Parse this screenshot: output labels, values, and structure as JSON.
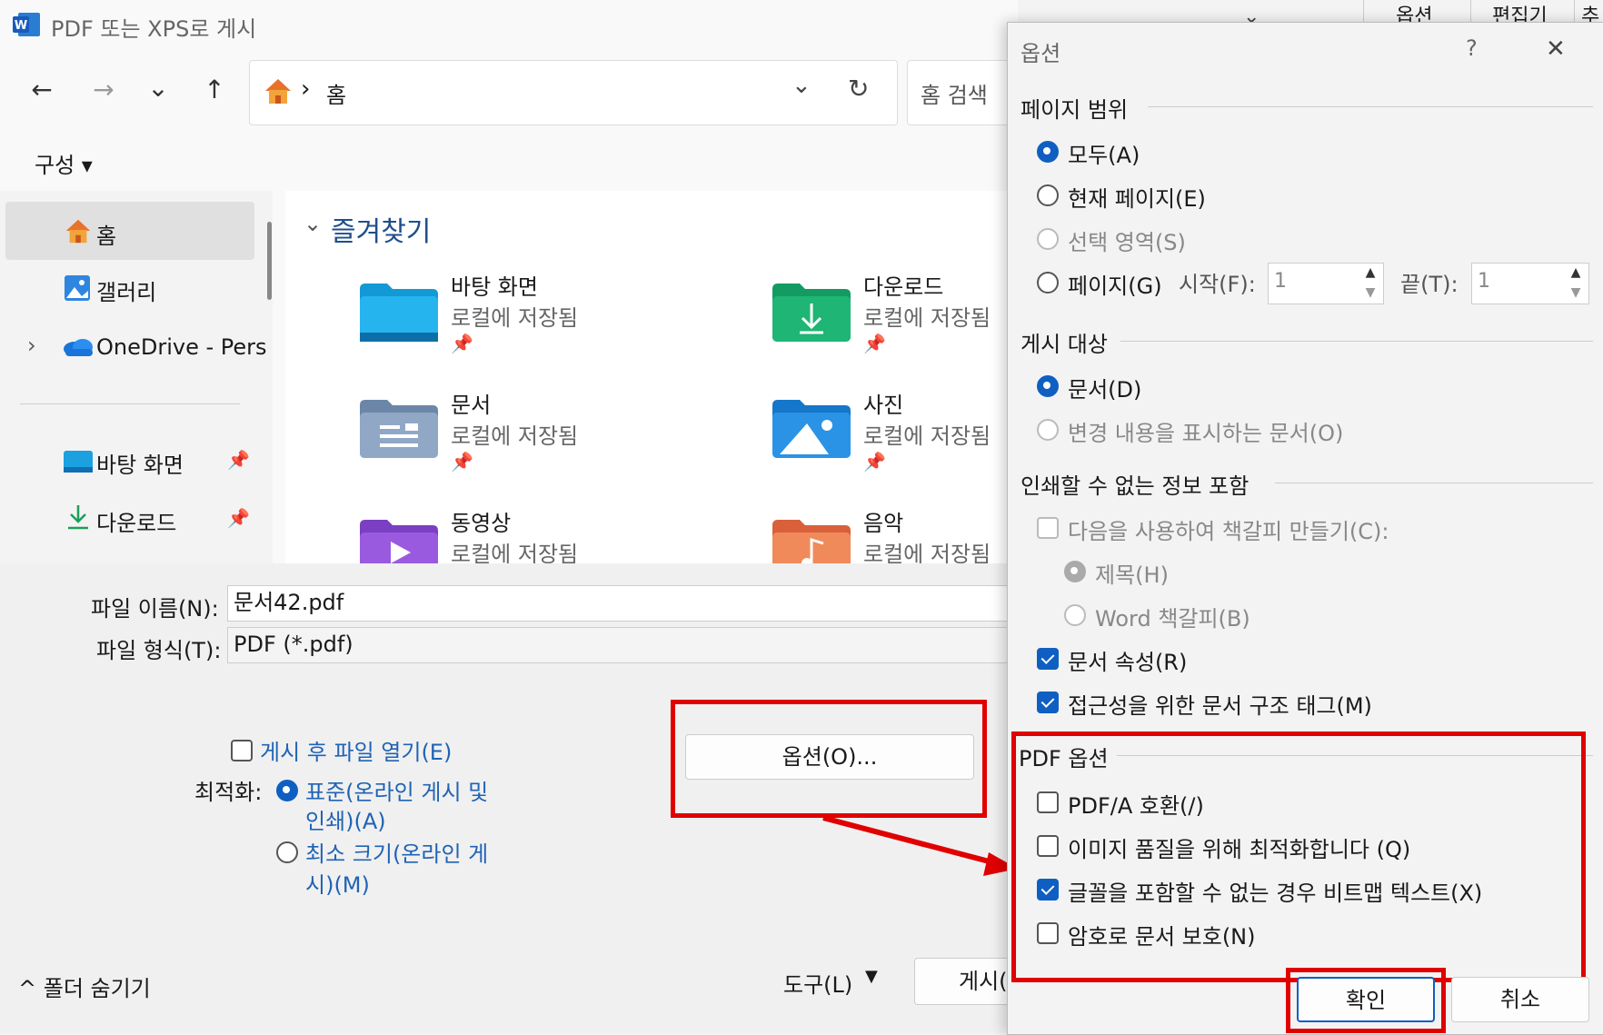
{
  "save_dialog": {
    "title": "PDF 또는 XPS로 게시",
    "nav": {
      "back": "←",
      "forward": "→",
      "recent": "⌄",
      "up": "↑"
    },
    "address": {
      "separator": "›",
      "location": "홈",
      "dropdown": "⌄",
      "refresh": "↻"
    },
    "search": {
      "placeholder": "홈 검색"
    },
    "organize_label": "구성 ▾",
    "sidebar": {
      "items": [
        {
          "label": "홈",
          "icon": "home-icon"
        },
        {
          "label": "갤러리",
          "icon": "gallery-icon"
        },
        {
          "label": "OneDrive - Pers",
          "icon": "onedrive-icon",
          "expander": "›"
        },
        {
          "label": "바탕 화면",
          "icon": "desktop-folder-icon",
          "pin": "📌"
        },
        {
          "label": "다운로드",
          "icon": "download-icon",
          "pin": "📌"
        }
      ]
    },
    "favorites": {
      "chevron": "⌄",
      "header": "즐겨찾기",
      "items": [
        {
          "name": "바탕 화면",
          "sub": "로컬에 저장됨",
          "icon": "desktop-folder-icon"
        },
        {
          "name": "다운로드",
          "sub": "로컬에 저장됨",
          "icon": "downloads-folder-icon"
        },
        {
          "name": "문서",
          "sub": "로컬에 저장됨",
          "icon": "documents-folder-icon"
        },
        {
          "name": "사진",
          "sub": "로컬에 저장됨",
          "icon": "pictures-folder-icon"
        },
        {
          "name": "동영상",
          "sub": "로컬에 저장됨",
          "icon": "videos-folder-icon"
        },
        {
          "name": "음악",
          "sub": "로컬에 저장됨",
          "icon": "music-folder-icon"
        }
      ],
      "pin": "📌"
    },
    "filename_label": "파일 이름(N):",
    "filename_value": "문서42.pdf",
    "filetype_label": "파일 형식(T):",
    "filetype_value": "PDF (*.pdf)",
    "open_after_label": "게시 후 파일 열기(E)",
    "optimize_label": "최적화:",
    "optimize_standard_line1": "표준(온라인 게시 및",
    "optimize_standard_line2": "인쇄)(A)",
    "optimize_min_line1": "최소 크기(온라인 게",
    "optimize_min_line2": "시)(M)",
    "options_button": "옵션(O)...",
    "hide_folders": "^ 폴더 숨기기",
    "tools_label": "도구(L)",
    "tools_arrow": "▼",
    "publish_button": "게시(",
    "background_ribbon": {
      "chevron": "⌄",
      "tab1": "옵션",
      "tab2": "편집기",
      "tab3": "추"
    }
  },
  "options_dialog": {
    "title": "옵션",
    "help": "?",
    "close": "✕",
    "page_range": {
      "header": "페이지 범위",
      "all": "모두(A)",
      "current": "현재 페이지(E)",
      "selection": "선택 영역(S)",
      "pages": "페이지(G)",
      "from_label": "시작(F):",
      "from_value": "1",
      "to_label": "끝(T):",
      "to_value": "1",
      "spin_up": "▲",
      "spin_down": "▼"
    },
    "publish_what": {
      "header": "게시 대상",
      "document": "문서(D)",
      "markup": "변경 내용을 표시하는 문서(O)"
    },
    "nonprint": {
      "header": "인쇄할 수 없는 정보 포함",
      "bookmarks": "다음을 사용하여 책갈피 만들기(C):",
      "headings": "제목(H)",
      "word_bookmarks": "Word 책갈피(B)",
      "properties": "문서 속성(R)",
      "structure_tags": "접근성을 위한 문서 구조 태그(M)"
    },
    "pdf_options": {
      "header": "PDF 옵션",
      "pdfa": "PDF/A 호환(/)",
      "optimize_images": "이미지 품질을 위해 최적화합니다 (Q)",
      "bitmap_text": "글꼴을 포함할 수 없는 경우 비트맵 텍스트(X)",
      "encrypt": "암호로 문서 보호(N)"
    },
    "ok": "확인",
    "cancel": "취소"
  },
  "colors": {
    "highlight": "#e00000",
    "accent": "#0f5fc2",
    "link": "#1f63b5"
  }
}
